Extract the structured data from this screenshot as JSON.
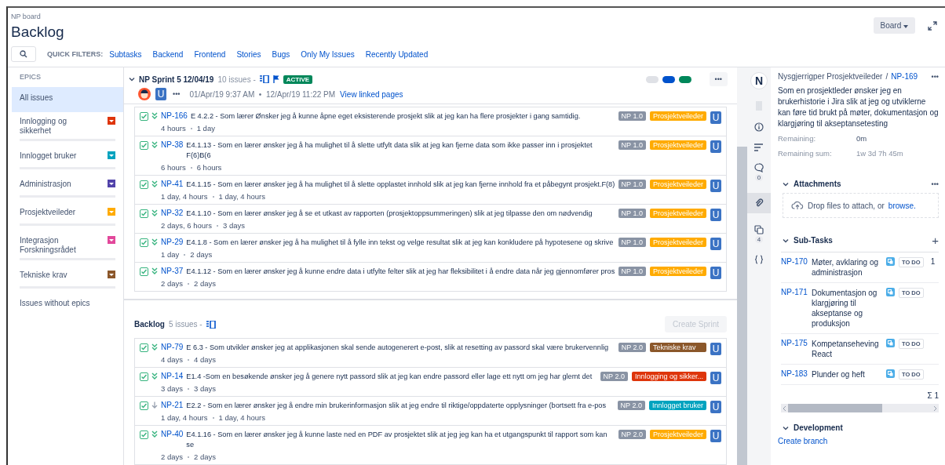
{
  "header": {
    "breadcrumb": "NP board",
    "title": "Backlog",
    "board_button": "Board"
  },
  "quick_filters": {
    "label": "QUICK FILTERS:",
    "items": [
      "Subtasks",
      "Backend",
      "Frontend",
      "Stories",
      "Bugs",
      "Only My Issues",
      "Recently Updated"
    ]
  },
  "epics": {
    "heading": "EPICS",
    "items": [
      {
        "label": "All issues",
        "selected": true
      },
      {
        "label": "Innlogging og sikkerhet",
        "color": "#de350b",
        "selected": false
      },
      {
        "label": "Innlogget bruker",
        "color": "#00a3bf",
        "selected": false
      },
      {
        "label": "Administrasjon",
        "color": "#5243aa",
        "selected": false
      },
      {
        "label": "Prosjektveileder",
        "color": "#ffab00",
        "selected": false
      },
      {
        "label": "Integrasjon Forskningsrådet",
        "color": "#e2489b",
        "selected": false
      },
      {
        "label": "Tekniske krav",
        "color": "#8b572a",
        "selected": false
      },
      {
        "label": "Issues without epics",
        "selected": false
      }
    ]
  },
  "sprint": {
    "name": "NP Sprint 5 12/04/19",
    "count": "10 issues -",
    "badge": "ACTIVE",
    "dates": "01/Apr/19 9:37 AM  •  12/Apr/19 11:22 PM",
    "link": "View linked pages",
    "avatar_letter": "U",
    "more": "•••",
    "status_pills": [
      {
        "color": "#dfe1e6"
      },
      {
        "color": "#0052cc"
      },
      {
        "color": "#00875a"
      }
    ],
    "issues": [
      {
        "key": "NP-166",
        "summary": "E 4.2.2 - Som lærer Ønsker jeg å kunne åpne eget eksisterende prosjekt slik at jeg kan ha flere prosjekter i gang samtidig.",
        "estimate": "4 hours",
        "remaining": "1 day",
        "version": "NP 1.0",
        "epic": "Prosjektveileder",
        "color": "#ffab00",
        "assignee": "U",
        "kind": "lowest"
      },
      {
        "key": "NP-38",
        "summary": "E4.1.13 - Som en lærer ønsker jeg å ha mulighet til å slette utfylt data slik at jeg kan fjerne data som ikke passer inn i prosjektet F(6)B(6",
        "estimate": "6 hours",
        "remaining": "6 hours",
        "version": "NP 1.0",
        "epic": "Prosjektveileder",
        "color": "#ffab00",
        "assignee": "U",
        "kind": "lowest"
      },
      {
        "key": "NP-41",
        "summary": "E4.1.15 - Som en lærer ønsker jeg å ha mulighet til å slette opplastet innhold slik at jeg kan fjerne innhold fra et påbegynt prosjekt.F(8)",
        "estimate": "1 day, 4 hours",
        "remaining": "1 day, 4 hours",
        "version": "NP 1.0",
        "epic": "Prosjektveileder",
        "color": "#ffab00",
        "assignee": "U",
        "kind": "lowest"
      },
      {
        "key": "NP-32",
        "summary": "E4.1.10 - Som en lærer ønsker jeg å se et utkast av rapporten (prosjektoppsummeringen) slik at jeg tilpasse den om nødvendig",
        "estimate": "2 days, 6 hours",
        "remaining": "3 days",
        "version": "NP 1.0",
        "epic": "Prosjektveileder",
        "color": "#ffab00",
        "assignee": "U",
        "kind": "lowest"
      },
      {
        "key": "NP-29",
        "summary": "E4.1.8 - Som en lærer ønsker jeg å ha mulighet til å fylle inn tekst og velge resultat slik at jeg kan konkludere på hypotesene og skrive",
        "estimate": "1 day",
        "remaining": "2 days",
        "version": "NP 1.0",
        "epic": "Prosjektveileder",
        "color": "#ffab00",
        "assignee": "U",
        "kind": "lowest"
      },
      {
        "key": "NP-37",
        "summary": "E4.1.12 - Som en lærer ønsker jeg å kunne endre data i utfylte felter slik at jeg har fleksibilitet i å endre data når jeg gjennomfører pros",
        "estimate": "2 days",
        "remaining": "2 days",
        "version": "NP 1.0",
        "epic": "Prosjektveileder",
        "color": "#ffab00",
        "assignee": "U",
        "kind": "lowest"
      }
    ]
  },
  "backlog": {
    "name": "Backlog",
    "count": "5 issues -",
    "create_button": "Create Sprint",
    "issues": [
      {
        "key": "NP-79",
        "summary": "E 6.3 - Som utvikler ønsker jeg at applikasjonen skal sende autogenerert e-post, slik at resetting av passord skal være brukervennlig",
        "estimate": "4 days",
        "remaining": "4 days",
        "version": "NP 2.0",
        "epic": "Tekniske krav",
        "color": "#8b572a",
        "assignee": "U",
        "kind": "lowest"
      },
      {
        "key": "NP-14",
        "summary": "E1.4 -Som en besøkende ønsker jeg å genere nytt passord slik at jeg kan endre passord eller lage ett nytt om jeg har glemt det",
        "estimate": "3 days",
        "remaining": "3 days",
        "version": "NP 2.0",
        "epic": "Innlogging og sikker...",
        "color": "#de350b",
        "assignee": "U",
        "kind": "lowest"
      },
      {
        "key": "NP-21",
        "summary": "E2.2 - Som en lærer ønsker jeg å endre min brukerinformasjon slik at jeg endre til riktige/oppdaterte opplysninger (bortsett fra e-pos",
        "estimate": "1 day, 4 hours",
        "remaining": "1 day, 4 hours",
        "version": "NP 2.0",
        "epic": "Innlogget bruker",
        "color": "#00a3bf",
        "assignee": "U",
        "kind": "low"
      },
      {
        "key": "NP-40",
        "summary": "E4.1.16 - Som en lærer ønsker jeg å kunne laste ned en PDF av prosjektet slik at jeg jeg kan ha et utgangspunkt til rapport som kan se",
        "estimate": "2 days",
        "remaining": "2 days",
        "version": "NP 2.0",
        "epic": "Prosjektveileder",
        "color": "#ffab00",
        "assignee": "U",
        "kind": "lowest"
      }
    ]
  },
  "rail": {
    "comments_count": "0",
    "subtasks_count": "4",
    "logo_letter": "N"
  },
  "detail": {
    "parent": "Nysgjerrigper Prosjektveileder",
    "separator": "/",
    "key": "NP-169",
    "more": "•••",
    "description": "Som en prosjektleder ønsker jeg en brukerhistorie i Jira slik at jeg og utviklerne kan føre tid brukt på møter, dokumentasjon og klargjøring til akseptansetesting",
    "fields": [
      {
        "label": "Remaining:",
        "value": "0m"
      },
      {
        "label": "Remaining sum:",
        "value": "1w 3d 7h 45m"
      }
    ],
    "attachments": {
      "title": "Attachments",
      "more": "•••",
      "drop_text": "Drop files to attach, or",
      "browse": "browse."
    },
    "subtasks": {
      "title": "Sub-Tasks",
      "add": "+",
      "items": [
        {
          "key": "NP-170",
          "summary": "Møter, avklaring og administrasjon",
          "status": "TO DO",
          "column_4": "1"
        },
        {
          "key": "NP-171",
          "summary": "Dokumentasjon og klargjøring til akseptanse og produksjon",
          "status": "TO DO"
        },
        {
          "key": "NP-175",
          "summary": "Kompetanseheving React",
          "status": "TO DO"
        },
        {
          "key": "NP-183",
          "summary": "Plunder og heft",
          "status": "TO DO"
        }
      ],
      "sum": "Σ 1"
    },
    "development": {
      "title": "Development",
      "link": "Create branch"
    }
  }
}
